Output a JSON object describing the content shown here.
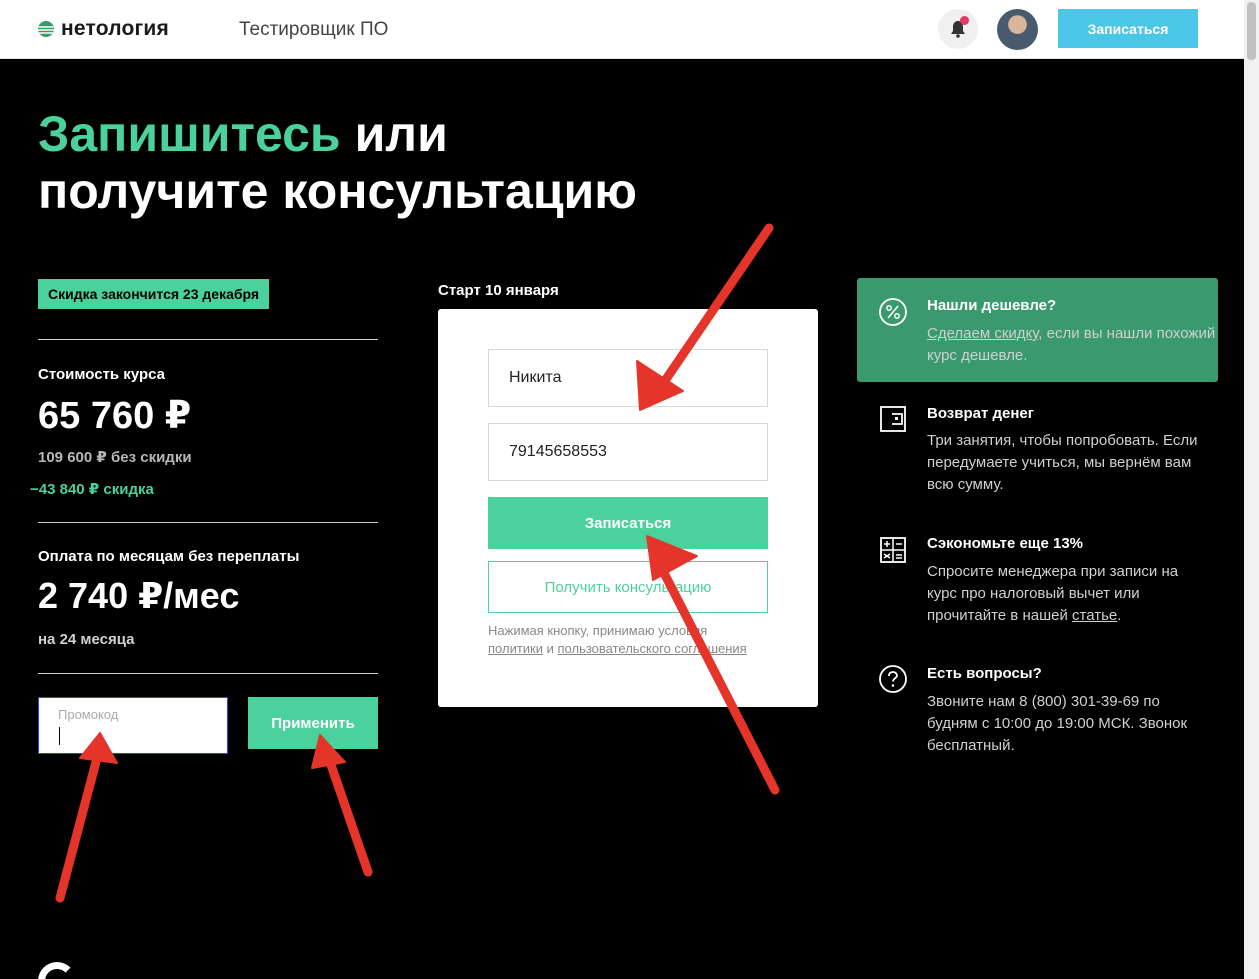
{
  "header": {
    "logo_text": "нетология",
    "course_name": "Тестировщик ПО",
    "signup_label": "Записаться"
  },
  "title": {
    "accent": "Запишитесь",
    "line1_rest": " или",
    "line2": "получите консультацию"
  },
  "pricing": {
    "discount_badge": "Скидка закончится 23 декабря",
    "price_label": "Стоимость курса",
    "price": "65 760 ₽",
    "old_price": "109 600 ₽ без скидки",
    "discount": "−43 840 ₽ скидка",
    "monthly_label": "Оплата по месяцам без переплаты",
    "monthly_price": "2 740 ₽/мес",
    "monthly_term": "на 24 месяца",
    "promo_placeholder": "Промокод",
    "apply_label": "Применить"
  },
  "form": {
    "start_date": "Старт 10 января",
    "name_value": "Никита",
    "phone_value": "79145658553",
    "signup_label": "Записаться",
    "consult_label": "Получить консультацию",
    "agree_prefix": "Нажимая кнопку, принимаю условия",
    "agree_link1": "политики",
    "agree_and": " и ",
    "agree_link2": "пользовательского соглашения"
  },
  "benefits": {
    "cheaper_title": "Нашли дешевле?",
    "cheaper_link": "Сделаем скидку",
    "cheaper_text": ", если вы нашли похожий курс дешевле.",
    "refund_title": "Возврат денег",
    "refund_text": "Три занятия, чтобы попробовать. Если передумаете учиться, мы вернём вам всю сумму.",
    "save_title": "Сэкономьте еще 13%",
    "save_text": "Спросите менеджера при записи на курс про налоговый вычет или прочитайте в нашей ",
    "save_link": "статье",
    "save_end": ".",
    "questions_title": "Есть вопросы?",
    "questions_text": "Звоните нам 8 (800) 301-39-69 по будням с 10:00 до 19:00 МСК. Звонок бесплатный."
  },
  "colors": {
    "accent_green": "#4bd19b",
    "box_green": "#3a9a6e",
    "header_cta": "#4cc6e6",
    "annotation_red": "#e5352b"
  }
}
